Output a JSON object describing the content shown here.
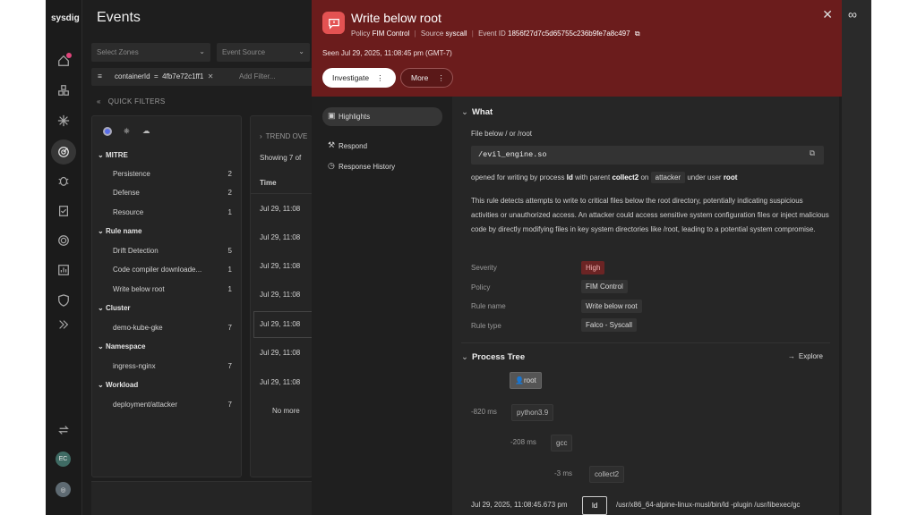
{
  "app": {
    "brand": "sysdig"
  },
  "page": {
    "title": "Events"
  },
  "filters": {
    "zones_placeholder": "Select Zones",
    "source_placeholder": "Event Source",
    "chip_key": "containerId",
    "chip_op": "=",
    "chip_value": "4fb7e72c1ff1",
    "add_filter_placeholder": "Add Filter..."
  },
  "quick_filters": {
    "label": "QUICK FILTERS",
    "groups": [
      {
        "name": "MITRE",
        "items": [
          {
            "label": "Persistence",
            "count": "2"
          },
          {
            "label": "Defense",
            "count": "2"
          },
          {
            "label": "Resource",
            "count": "1"
          }
        ]
      },
      {
        "name": "Rule name",
        "items": [
          {
            "label": "Drift Detection",
            "count": "5"
          },
          {
            "label": "Code compiler downloade...",
            "count": "1"
          },
          {
            "label": "Write below root",
            "count": "1"
          }
        ]
      },
      {
        "name": "Cluster",
        "items": [
          {
            "label": "demo-kube-gke",
            "count": "7"
          }
        ]
      },
      {
        "name": "Namespace",
        "items": [
          {
            "label": "ingress-nginx",
            "count": "7"
          }
        ]
      },
      {
        "name": "Workload",
        "items": [
          {
            "label": "deployment/attacker",
            "count": "7"
          }
        ]
      }
    ]
  },
  "events_list": {
    "trend_label": "TREND OVE",
    "showing": "Showing 7 of",
    "time_header": "Time",
    "rows": [
      "Jul 29, 11:08",
      "Jul 29, 11:08",
      "Jul 29, 11:08",
      "Jul 29, 11:08",
      "Jul 29, 11:08",
      "Jul 29, 11:08",
      "Jul 29, 11:08"
    ],
    "no_more": "No more"
  },
  "drawer": {
    "title": "Write below root",
    "policy_label": "Policy",
    "policy_value": "FIM Control",
    "source_label": "Source",
    "source_value": "syscall",
    "event_id_label": "Event ID",
    "event_id_value": "1856f27d7c5d65755c236b9fe7a8c497",
    "seen": "Seen Jul 29, 2025, 11:08:45 pm (GMT-7)",
    "investigate_label": "Investigate",
    "more_label": "More",
    "nav": [
      {
        "label": "Highlights",
        "icon": "highlights-icon"
      },
      {
        "label": "Respond",
        "icon": "wrench-icon"
      },
      {
        "label": "Response History",
        "icon": "history-icon"
      }
    ],
    "what": {
      "heading": "What",
      "file_line": "File below / or /root",
      "path": "/evil_engine.so",
      "opened_pre": "opened for writing by process",
      "process": "ld",
      "opened_mid": "with parent",
      "parent": "collect2",
      "on": "on",
      "host": "attacker",
      "under": "under user",
      "user": "root",
      "description": "This rule detects attempts to write to critical files below the root directory, potentially indicating suspicious activities or unauthorized access. An attacker could access sensitive system configuration files or inject malicious code by directly modifying files in key system directories like /root, leading to a potential system compromise.",
      "fields": [
        {
          "label": "Severity",
          "value": "High"
        },
        {
          "label": "Policy",
          "value": "FIM Control"
        },
        {
          "label": "Rule name",
          "value": "Write below root"
        },
        {
          "label": "Rule type",
          "value": "Falco - Syscall"
        }
      ]
    },
    "process_tree": {
      "heading": "Process Tree",
      "explore": "Explore",
      "nodes": [
        {
          "label": "root",
          "ms": ""
        },
        {
          "label": "python3.9",
          "ms": "-820 ms"
        },
        {
          "label": "gcc",
          "ms": "-208 ms"
        },
        {
          "label": "collect2",
          "ms": "-3 ms"
        }
      ],
      "last_time": "Jul 29, 2025, 11:08:45.673 pm",
      "last_proc": "ld",
      "last_cmd": "/usr/x86_64-alpine-linux-musl/bin/ld -plugin /usr/libexec/gc"
    }
  },
  "colors": {
    "header_bg": "#6b1c1c",
    "severity_high": "#6b2424",
    "accent": "#e35252"
  }
}
